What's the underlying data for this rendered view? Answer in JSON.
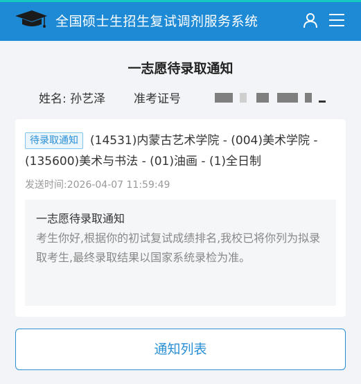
{
  "header": {
    "app_title": "全国硕士生招生复试调剂服务系统",
    "logo_icon": "graduation-cap-icon",
    "user_icon": "user-icon",
    "menu_icon": "hamburger-menu-icon",
    "bg_color": "#1e8ad6"
  },
  "page": {
    "title": "一志愿待录取通知"
  },
  "candidate": {
    "name_label": "姓名:",
    "name_value": "孙艺泽",
    "exam_id_label": "准考证号"
  },
  "notice": {
    "badge": "待录取通知",
    "program": "(14531)内蒙古艺术学院 - (004)美术学院 - (135600)美术与书法 - (01)油画 - (1)全日制",
    "send_time": "发送时间:2026-04-07 11:59:49",
    "message_title": "一志愿待录取通知",
    "message_body": "考生你好,根据你的初试复试成绩排名,我校已将你列为拟录取考生,最终录取结果以国家系统录检为准。"
  },
  "actions": {
    "list_button": "通知列表"
  }
}
